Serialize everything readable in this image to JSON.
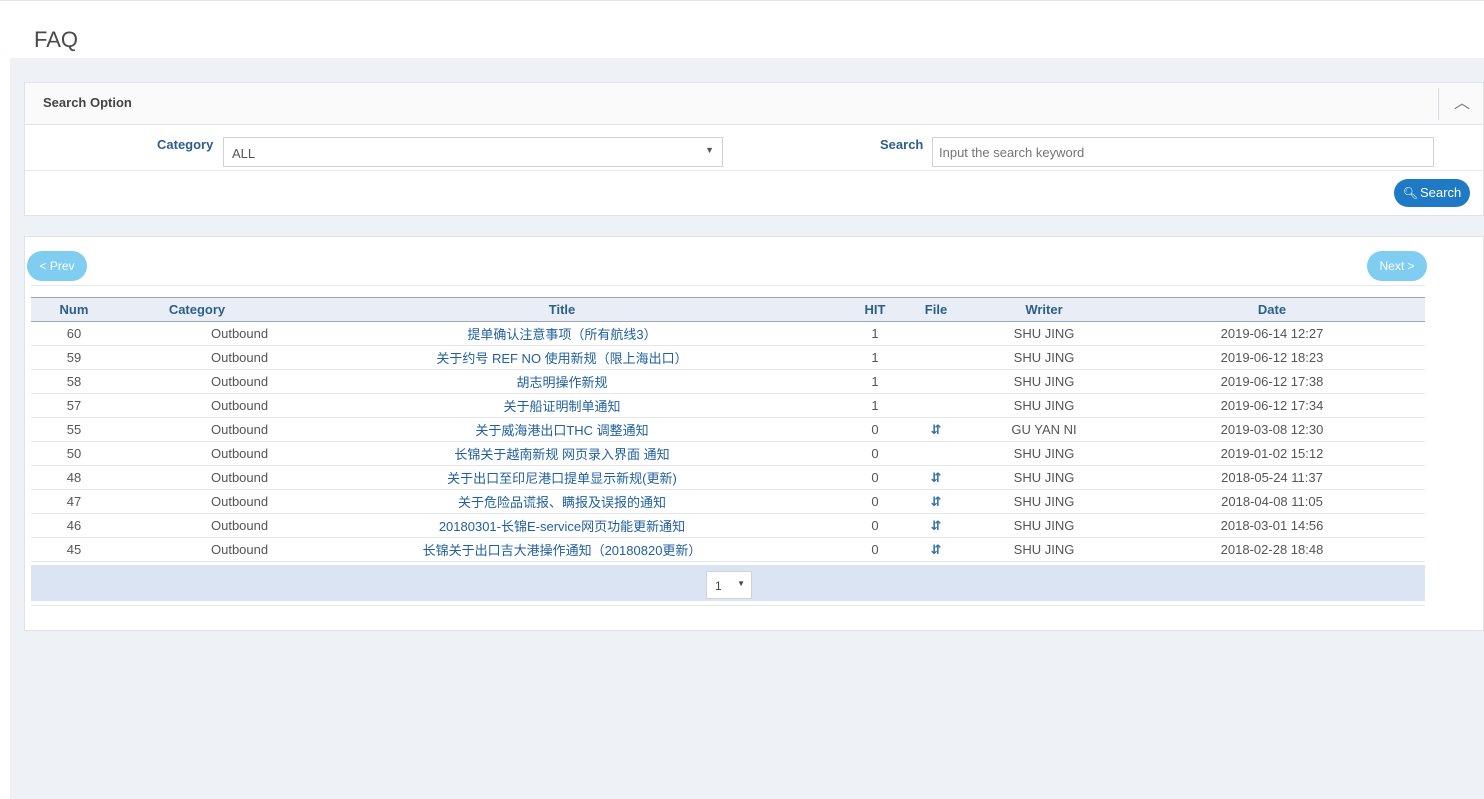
{
  "page": {
    "title": "FAQ"
  },
  "search_panel": {
    "title": "Search Option",
    "category_label": "Category",
    "category_value": "ALL",
    "search_label": "Search",
    "search_placeholder": "Input the search keyword",
    "search_value": "",
    "search_button": "Search"
  },
  "list": {
    "prev_label": "< Prev",
    "next_label": "Next >",
    "columns": [
      "Num",
      "Category",
      "Title",
      "HIT",
      "File",
      "Writer",
      "Date"
    ],
    "rows": [
      {
        "num": "60",
        "category": "Outbound",
        "title": "提单确认注意事项（所有航线3）",
        "hit": "1",
        "file": false,
        "writer": "SHU JING",
        "date": "2019-06-14 12:27"
      },
      {
        "num": "59",
        "category": "Outbound",
        "title": "关于约号 REF NO 使用新规（限上海出口）",
        "hit": "1",
        "file": false,
        "writer": "SHU JING",
        "date": "2019-06-12 18:23"
      },
      {
        "num": "58",
        "category": "Outbound",
        "title": "胡志明操作新规",
        "hit": "1",
        "file": false,
        "writer": "SHU JING",
        "date": "2019-06-12 17:38"
      },
      {
        "num": "57",
        "category": "Outbound",
        "title": "关于船证明制单通知",
        "hit": "1",
        "file": false,
        "writer": "SHU JING",
        "date": "2019-06-12 17:34"
      },
      {
        "num": "55",
        "category": "Outbound",
        "title": "关于威海港出口THC 调整通知",
        "hit": "0",
        "file": true,
        "writer": "GU YAN NI",
        "date": "2019-03-08 12:30"
      },
      {
        "num": "50",
        "category": "Outbound",
        "title": "长锦关于越南新规 网页录入界面 通知",
        "hit": "0",
        "file": false,
        "writer": "SHU JING",
        "date": "2019-01-02 15:12"
      },
      {
        "num": "48",
        "category": "Outbound",
        "title": "关于出口至印尼港口提单显示新规(更新)",
        "hit": "0",
        "file": true,
        "writer": "SHU JING",
        "date": "2018-05-24 11:37"
      },
      {
        "num": "47",
        "category": "Outbound",
        "title": "关于危险品谎报、瞒报及误报的通知",
        "hit": "0",
        "file": true,
        "writer": "SHU JING",
        "date": "2018-04-08 11:05"
      },
      {
        "num": "46",
        "category": "Outbound",
        "title": "20180301-长锦E-service网页功能更新通知",
        "hit": "0",
        "file": true,
        "writer": "SHU JING",
        "date": "2018-03-01 14:56"
      },
      {
        "num": "45",
        "category": "Outbound",
        "title": "长锦关于出口吉大港操作通知（20180820更新）",
        "hit": "0",
        "file": true,
        "writer": "SHU JING",
        "date": "2018-02-28 18:48"
      }
    ],
    "page_select_value": "1"
  },
  "icons": {
    "collapse": "chevron-up-icon",
    "search": "search-icon",
    "file": "file-attachment-icon"
  }
}
